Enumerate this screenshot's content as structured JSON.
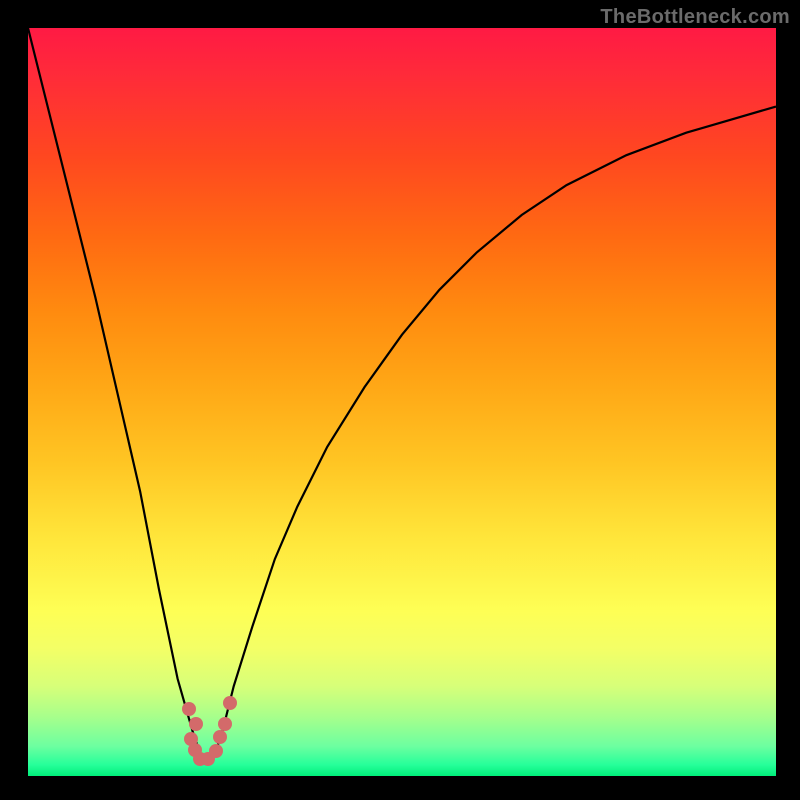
{
  "watermark": "TheBottleneck.com",
  "chart_data": {
    "type": "line",
    "title": "",
    "xlabel": "",
    "ylabel": "",
    "xlim": [
      0,
      100
    ],
    "ylim": [
      0,
      100
    ],
    "series": [
      {
        "name": "bottleneck-curve",
        "x": [
          0,
          3,
          6,
          9,
          12,
          15,
          17.5,
          20,
          22,
          23,
          24,
          25,
          26,
          27.5,
          30,
          33,
          36,
          40,
          45,
          50,
          55,
          60,
          66,
          72,
          80,
          88,
          100
        ],
        "values": [
          100,
          88,
          76,
          64,
          51,
          38,
          25,
          13,
          6,
          3,
          2,
          3,
          6,
          12,
          20,
          29,
          36,
          44,
          52,
          59,
          65,
          70,
          75,
          79,
          83,
          86,
          89.5
        ]
      }
    ],
    "scatter": {
      "name": "data-points",
      "x": [
        21.5,
        22.5,
        21.8,
        22.3,
        23.0,
        24.0,
        25.2,
        25.7,
        26.3,
        27.0
      ],
      "values": [
        9.0,
        7.0,
        5.0,
        3.5,
        2.3,
        2.3,
        3.3,
        5.2,
        7.0,
        9.8
      ]
    },
    "gradient_bands": [
      {
        "pct": 0,
        "color": "#ff1a44"
      },
      {
        "pct": 6,
        "color": "#ff2a3a"
      },
      {
        "pct": 17,
        "color": "#ff4720"
      },
      {
        "pct": 28,
        "color": "#ff6a12"
      },
      {
        "pct": 38,
        "color": "#ff8b0f"
      },
      {
        "pct": 47,
        "color": "#ffa515"
      },
      {
        "pct": 58,
        "color": "#ffc523"
      },
      {
        "pct": 68,
        "color": "#ffe53a"
      },
      {
        "pct": 78,
        "color": "#feff55"
      },
      {
        "pct": 83,
        "color": "#f3ff66"
      },
      {
        "pct": 88,
        "color": "#d7ff79"
      },
      {
        "pct": 92,
        "color": "#a8ff8b"
      },
      {
        "pct": 96,
        "color": "#6dffa0"
      },
      {
        "pct": 98.5,
        "color": "#26ff9a"
      },
      {
        "pct": 100,
        "color": "#00ee7a"
      }
    ]
  }
}
